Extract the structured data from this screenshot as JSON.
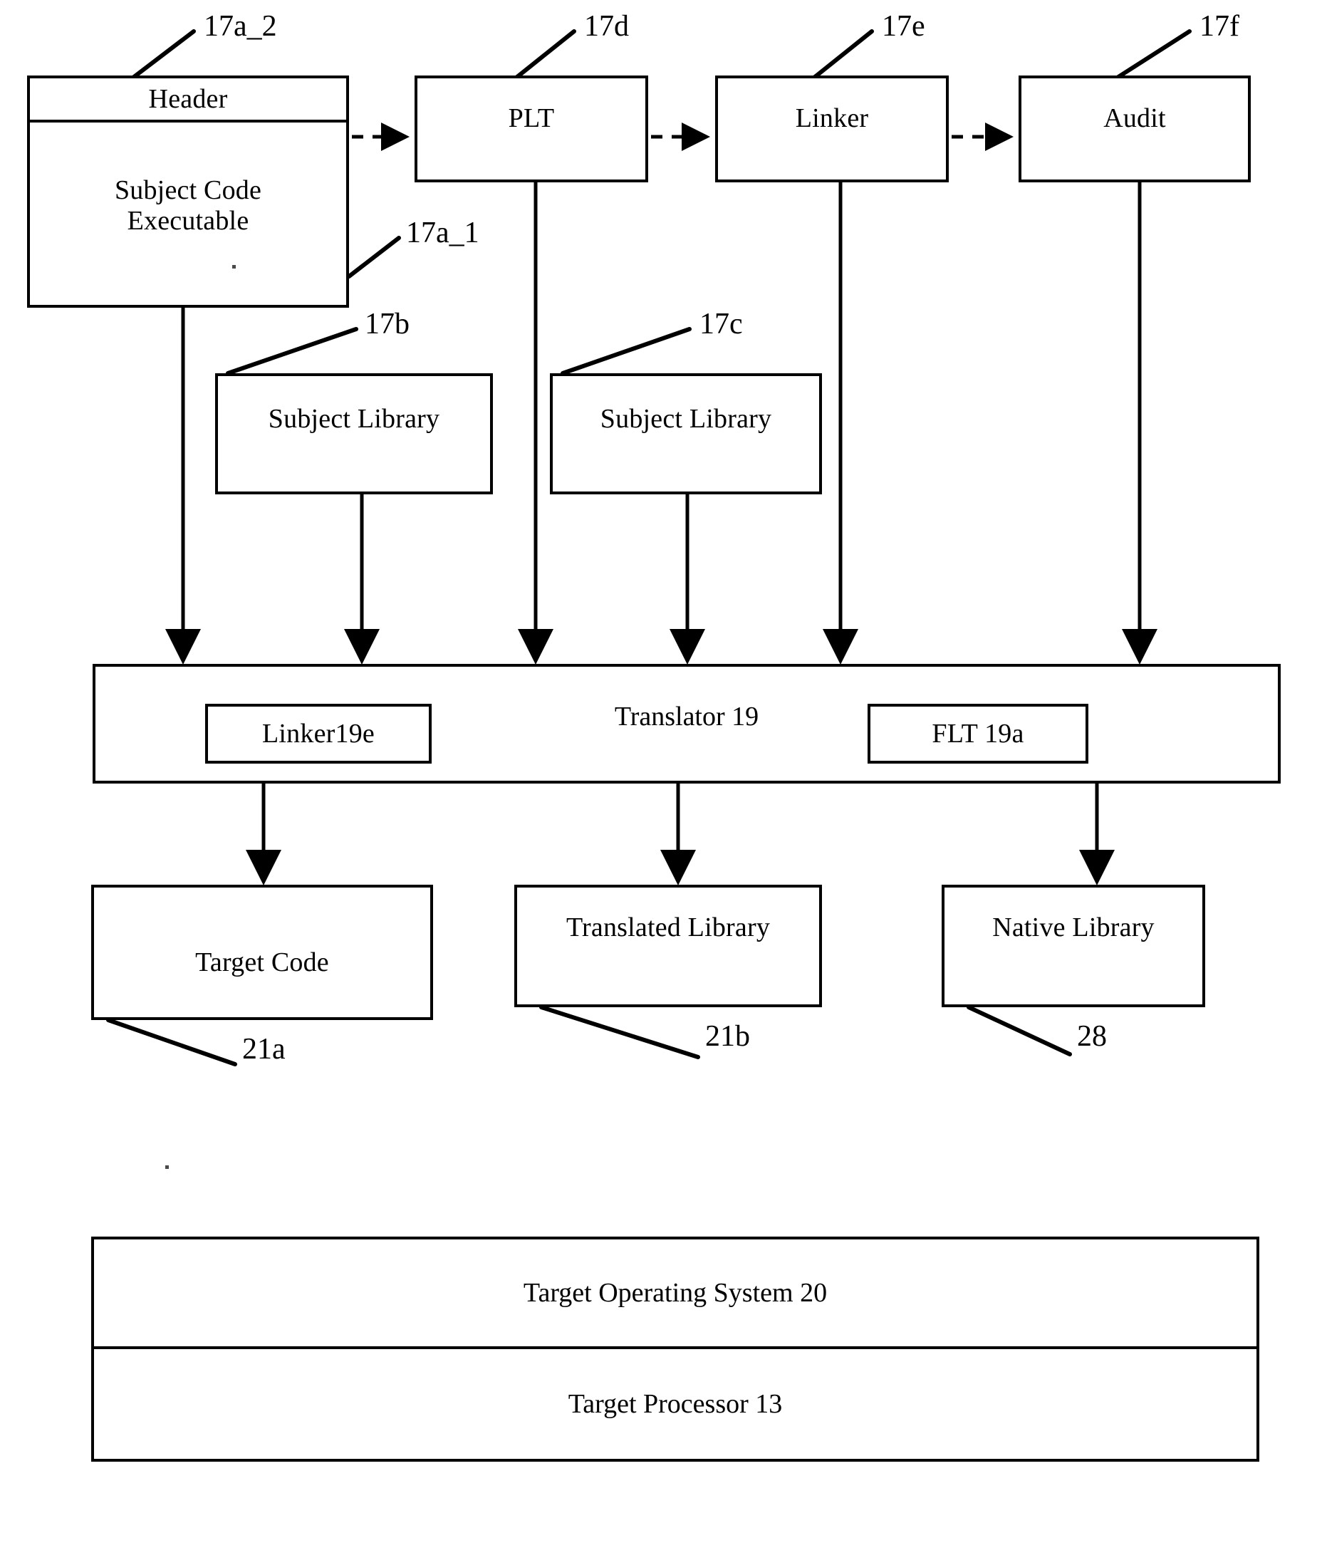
{
  "figure": {
    "type": "patent-block-diagram",
    "nodes": {
      "header": "Header",
      "subject_code_executable": "Subject Code\nExecutable",
      "plt": "PLT",
      "linker": "Linker",
      "audit": "Audit",
      "subject_library_b": "Subject Library",
      "subject_library_c": "Subject Library",
      "translator": "Translator 19",
      "linker19e": "Linker19e",
      "flt19a": "FLT 19a",
      "target_code": "Target Code",
      "translated_library": "Translated Library",
      "native_library": "Native Library",
      "target_operating_system": "Target Operating System 20",
      "target_processor": "Target Processor 13"
    },
    "subject_code_executable_lines": {
      "line1": "Subject Code",
      "line2": "Executable"
    },
    "reference_numerals": {
      "header_ref": "17a_2",
      "subject_code_ref": "17a_1",
      "subject_library_b_ref": "17b",
      "subject_library_c_ref": "17c",
      "plt_ref": "17d",
      "linker_ref": "17e",
      "audit_ref": "17f",
      "target_code_ref": "21a",
      "translated_library_ref": "21b",
      "native_library_ref": "28"
    },
    "colors": {
      "stroke": "#000000",
      "background": "#ffffff"
    }
  }
}
